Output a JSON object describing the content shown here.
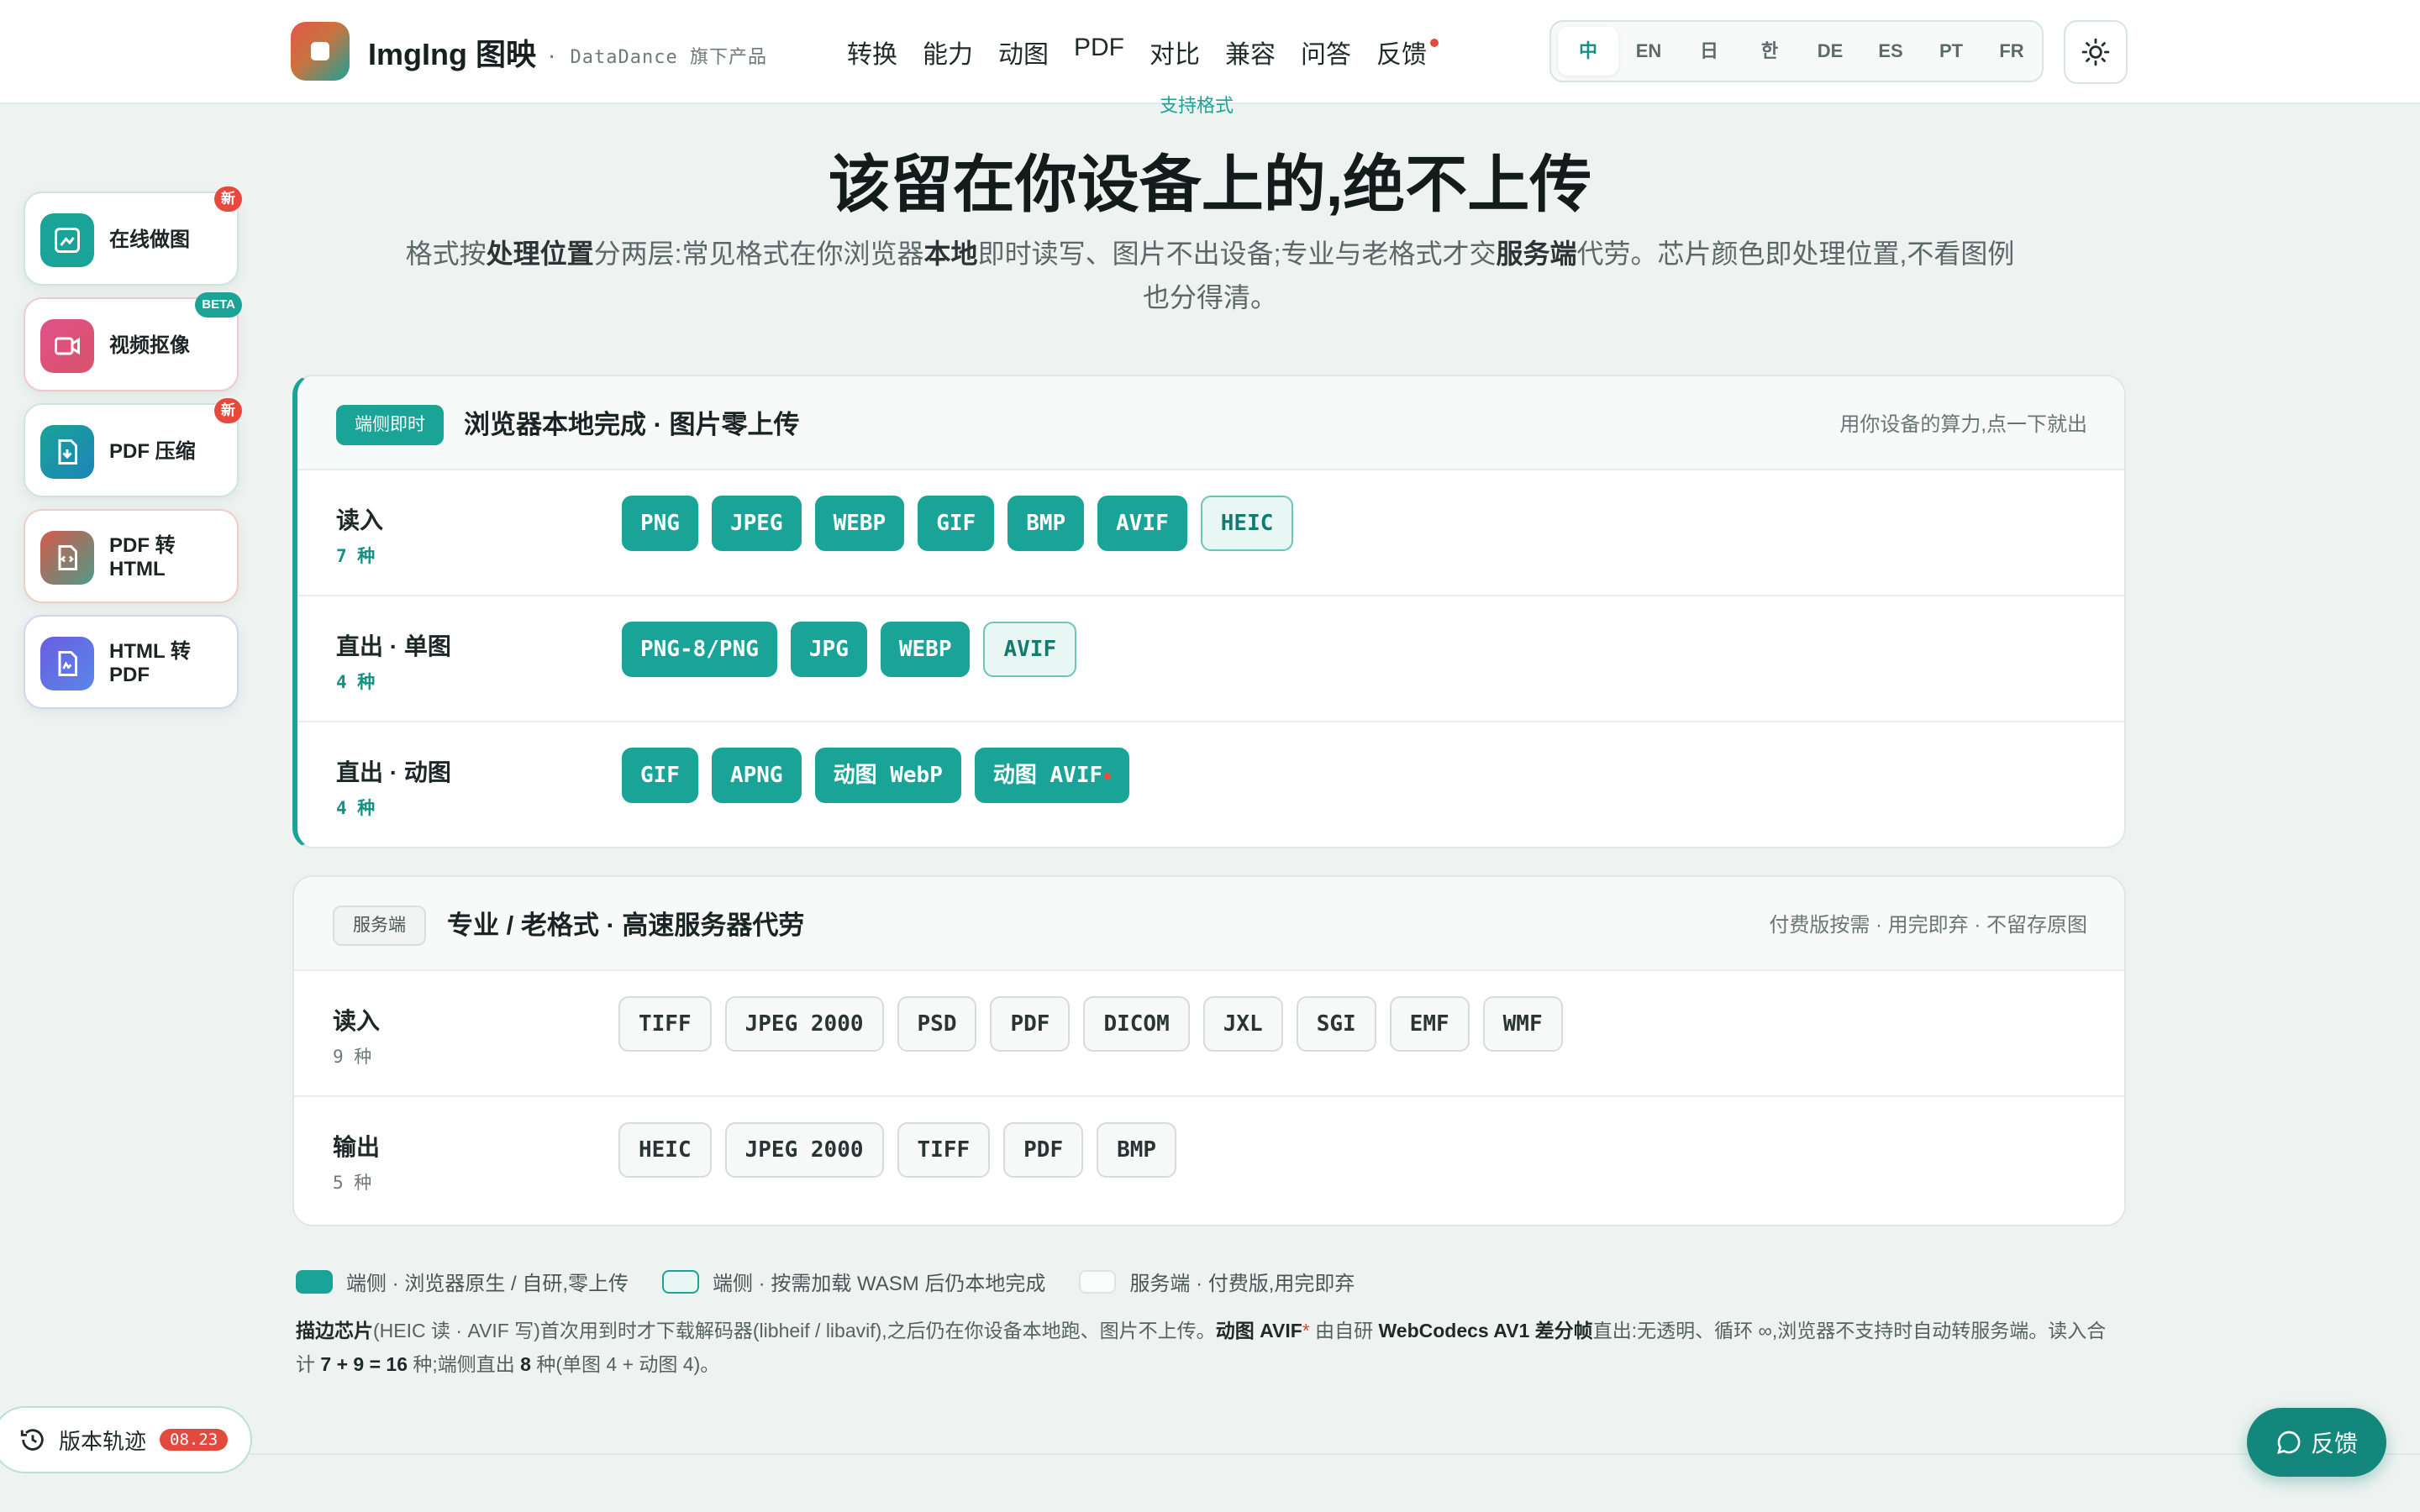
{
  "header": {
    "brand": "ImgIng 图映",
    "brand_sub": "· DataDance 旗下产品",
    "nav": [
      "转换",
      "能力",
      "动图",
      "PDF",
      "对比",
      "兼容",
      "问答",
      "反馈"
    ],
    "languages": [
      "中",
      "EN",
      "日",
      "한",
      "DE",
      "ES",
      "PT",
      "FR"
    ],
    "active_language": "中"
  },
  "side_tools": [
    {
      "label": "在线做图",
      "badge": "新"
    },
    {
      "label": "视频抠像",
      "badge": "BETA"
    },
    {
      "label": "PDF 压缩",
      "badge": "新"
    },
    {
      "label": "PDF 转 HTML",
      "badge": ""
    },
    {
      "label": "HTML 转 PDF",
      "badge": ""
    }
  ],
  "hero": {
    "kicker": "支持格式",
    "title": "该留在你设备上的,绝不上传",
    "desc_parts": [
      "格式按",
      "处理位置",
      "分两层:常见格式在你浏览器",
      "本地",
      "即时读写、图片不出设备;专业与老格式才交",
      "服务端",
      "代劳。芯片颜色即处理位置,不看图例也分得清。"
    ]
  },
  "client_panel": {
    "tag": "端侧即时",
    "title": "浏览器本地完成 · 图片零上传",
    "note": "用你设备的算力,点一下就出",
    "rows": [
      {
        "label": "读入",
        "count": "7 种",
        "chips": [
          {
            "text": "PNG",
            "kind": "solid"
          },
          {
            "text": "JPEG",
            "kind": "solid"
          },
          {
            "text": "WEBP",
            "kind": "solid"
          },
          {
            "text": "GIF",
            "kind": "solid"
          },
          {
            "text": "BMP",
            "kind": "solid"
          },
          {
            "text": "AVIF",
            "kind": "solid"
          },
          {
            "text": "HEIC",
            "kind": "wasm"
          }
        ]
      },
      {
        "label": "直出 · 单图",
        "count": "4 种",
        "chips": [
          {
            "text": "PNG-8/PNG",
            "kind": "solid"
          },
          {
            "text": "JPG",
            "kind": "solid"
          },
          {
            "text": "WEBP",
            "kind": "solid"
          },
          {
            "text": "AVIF",
            "kind": "wasm"
          }
        ]
      },
      {
        "label": "直出 · 动图",
        "count": "4 种",
        "chips": [
          {
            "text": "GIF",
            "kind": "solid"
          },
          {
            "text": "APNG",
            "kind": "solid"
          },
          {
            "text": "动图 WebP",
            "kind": "solid"
          },
          {
            "text": "动图 AVIF",
            "kind": "solid",
            "dot": true
          }
        ]
      }
    ]
  },
  "server_panel": {
    "tag": "服务端",
    "title": "专业 / 老格式 · 高速服务器代劳",
    "note": "付费版按需 · 用完即弃 · 不留存原图",
    "rows": [
      {
        "label": "读入",
        "count": "9 种",
        "chips": [
          {
            "text": "TIFF",
            "kind": "server"
          },
          {
            "text": "JPEG 2000",
            "kind": "server"
          },
          {
            "text": "PSD",
            "kind": "server"
          },
          {
            "text": "PDF",
            "kind": "server"
          },
          {
            "text": "DICOM",
            "kind": "server"
          },
          {
            "text": "JXL",
            "kind": "server"
          },
          {
            "text": "SGI",
            "kind": "server"
          },
          {
            "text": "EMF",
            "kind": "server"
          },
          {
            "text": "WMF",
            "kind": "server"
          }
        ]
      },
      {
        "label": "输出",
        "count": "5 种",
        "chips": [
          {
            "text": "HEIC",
            "kind": "server"
          },
          {
            "text": "JPEG 2000",
            "kind": "server"
          },
          {
            "text": "TIFF",
            "kind": "server"
          },
          {
            "text": "PDF",
            "kind": "server"
          },
          {
            "text": "BMP",
            "kind": "server"
          }
        ]
      }
    ]
  },
  "legend": [
    {
      "label": "端侧 · 浏览器原生 / 自研,零上传",
      "kind": "solid"
    },
    {
      "label": "端侧 · 按需加载 WASM 后仍本地完成",
      "kind": "wasm"
    },
    {
      "label": "服务端 · 付费版,用完即弃",
      "kind": "server"
    }
  ],
  "footnote": {
    "p1": "描边芯片",
    "p2": "(HEIC 读 · AVIF 写)首次用到时才下载解码器(libheif / libavif),之后仍在你设备本地跑、图片不上传。",
    "p3": "动图 AVIF",
    "p4": "*",
    "p5": " 由自研 ",
    "p6": "WebCodecs AV1 差分帧",
    "p7": "直出:无透明、循环 ∞,浏览器不支持时自动转服务端。读入合计 ",
    "p8": "7 + 9 = 16",
    "p9": " 种;端侧直出 ",
    "p10": "8",
    "p11": " 种(单图 4 + 动图 4)。"
  },
  "changelog": {
    "label": "版本轨迹",
    "badge": "08.23"
  },
  "feedback": {
    "label": "反馈"
  },
  "colors": {
    "accent": "#1aa397",
    "accent_dark": "#14877c",
    "alert": "#e4483d"
  }
}
